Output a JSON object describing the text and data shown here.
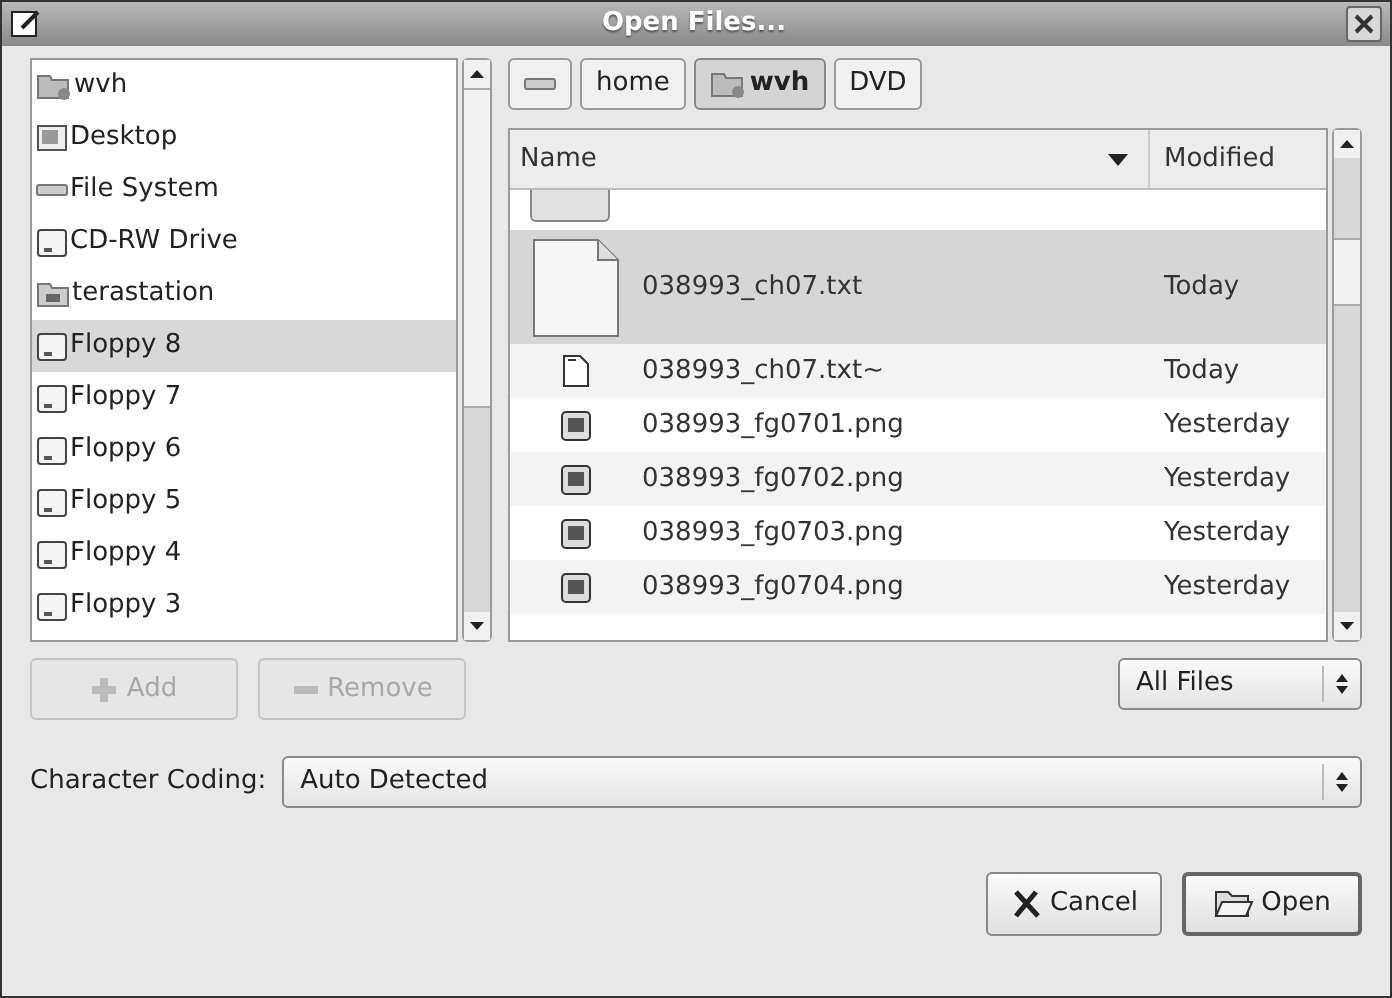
{
  "window": {
    "title": "Open Files..."
  },
  "places": [
    {
      "label": "wvh",
      "kind": "home",
      "selected": false
    },
    {
      "label": "Desktop",
      "kind": "desktop",
      "selected": false
    },
    {
      "label": "File System",
      "kind": "drive",
      "selected": false
    },
    {
      "label": "CD-RW Drive",
      "kind": "disk",
      "selected": false
    },
    {
      "label": "terastation",
      "kind": "network",
      "selected": false
    },
    {
      "label": "Floppy 8",
      "kind": "disk",
      "selected": true
    },
    {
      "label": "Floppy 7",
      "kind": "disk",
      "selected": false
    },
    {
      "label": "Floppy 6",
      "kind": "disk",
      "selected": false
    },
    {
      "label": "Floppy 5",
      "kind": "disk",
      "selected": false
    },
    {
      "label": "Floppy 4",
      "kind": "disk",
      "selected": false
    },
    {
      "label": "Floppy 3",
      "kind": "disk",
      "selected": false
    }
  ],
  "place_buttons": [
    {
      "label": "Add",
      "disabled": true
    },
    {
      "label": "Remove",
      "disabled": true
    }
  ],
  "path_bar": [
    {
      "kind": "drive",
      "selected": false
    },
    {
      "label": "home",
      "kind": "text",
      "selected": false
    },
    {
      "label": "wvh",
      "kind": "home",
      "selected": true
    },
    {
      "label": "DVD",
      "kind": "text",
      "selected": false
    }
  ],
  "file_table": {
    "columns": [
      "Name",
      "Modified"
    ],
    "rows": [
      {
        "name": "038993_ch07.txt",
        "modified": "Today",
        "kind": "preview",
        "selected": true
      },
      {
        "name": "038993_ch07.txt~",
        "modified": "Today",
        "kind": "text",
        "selected": false
      },
      {
        "name": "038993_fg0701.png",
        "modified": "Yesterday",
        "kind": "image",
        "selected": false
      },
      {
        "name": "038993_fg0702.png",
        "modified": "Yesterday",
        "kind": "image",
        "selected": false
      },
      {
        "name": "038993_fg0703.png",
        "modified": "Yesterday",
        "kind": "image",
        "selected": false
      },
      {
        "name": "038993_fg0704.png",
        "modified": "Yesterday",
        "kind": "image",
        "selected": false
      }
    ]
  },
  "filter": {
    "value": "All Files"
  },
  "encoding": {
    "label": "Character Coding:",
    "value": "Auto Detected"
  },
  "buttons": [
    {
      "label": "Cancel",
      "kind": "cancel"
    },
    {
      "label": "Open",
      "kind": "open"
    }
  ]
}
